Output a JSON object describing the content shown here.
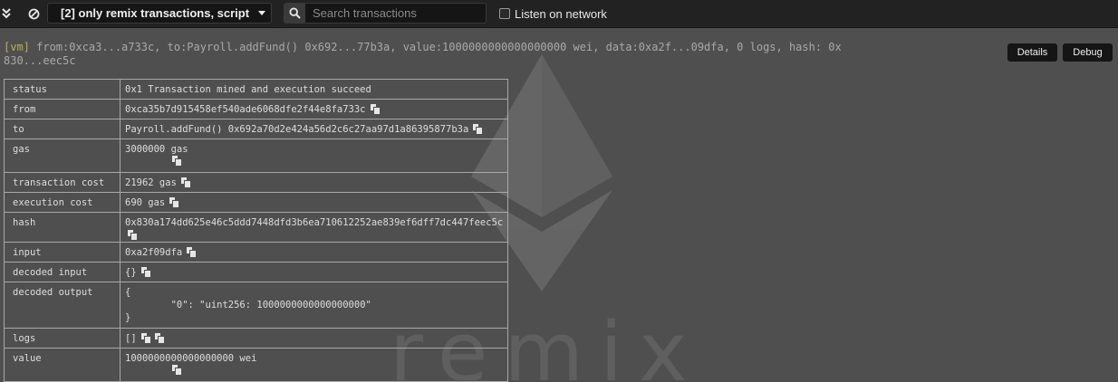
{
  "topbar": {
    "collapse_icon": "double-chevron-down-icon",
    "clear_icon": "no-entry-icon",
    "filter_label": "[2] only remix transactions, script",
    "search_placeholder": "Search transactions",
    "search_value": "",
    "listen_label": "Listen on network",
    "listen_checked": false
  },
  "summary": {
    "tag": "[vm]",
    "text": " from:0xca3...a733c, to:Payroll.addFund() 0x692...77b3a, value:1000000000000000000 wei, data:0xa2f...09dfa, 0 logs, hash: 0x830...eec5c"
  },
  "buttons": {
    "details": "Details",
    "debug": "Debug"
  },
  "table": {
    "status": {
      "key": "status",
      "value": "0x1 Transaction mined and execution succeed"
    },
    "from": {
      "key": "from",
      "value": "0xca35b7d915458ef540ade6068dfe2f44e8fa733c"
    },
    "to": {
      "key": "to",
      "value": "Payroll.addFund() 0x692a70d2e424a56d2c6c27aa97d1a86395877b3a"
    },
    "gas": {
      "key": "gas",
      "value": "3000000 gas"
    },
    "transaction_cost": {
      "key": "transaction cost",
      "value": "21962 gas"
    },
    "execution_cost": {
      "key": "execution cost",
      "value": "690 gas"
    },
    "hash": {
      "key": "hash",
      "value": "0x830a174dd625e46c5ddd7448dfd3b6ea710612252ae839ef6dff7dc447feec5c"
    },
    "input": {
      "key": "input",
      "value": "0xa2f09dfa"
    },
    "decoded_input": {
      "key": "decoded input",
      "value": "{}"
    },
    "decoded_output": {
      "key": "decoded output",
      "value": "{\n\t\"0\": \"uint256: 1000000000000000000\"\n}"
    },
    "logs": {
      "key": "logs",
      "value": "[]"
    },
    "value": {
      "key": "value",
      "value": "1000000000000000000 wei"
    }
  },
  "watermark": {
    "logo": "ethereum-diamond",
    "text": "remix"
  },
  "colors": {
    "background": "#4f4f4f",
    "topbar": "#222222",
    "vm_tag": "#b9b14f"
  }
}
